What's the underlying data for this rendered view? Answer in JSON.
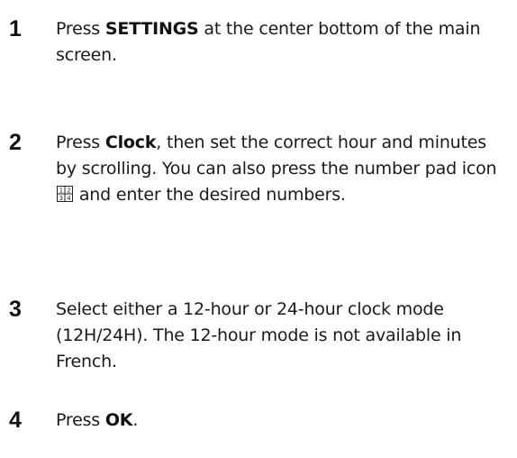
{
  "steps": [
    {
      "number": "1",
      "text_before": "Press ",
      "bold": "SETTINGS",
      "text_after": " at the center bottom of the main screen."
    },
    {
      "number": "2",
      "text_before": "Press ",
      "bold": "Clock",
      "text_mid": ", then set the correct hour and minutes by scrolling. You can also press the number pad icon ",
      "icon": "number-pad-icon",
      "text_after": " and enter the desired numbers."
    },
    {
      "number": "3",
      "text": "Select either a 12-hour or 24-hour clock mode (12H/24H). The 12-hour mode is not available in French."
    },
    {
      "number": "4",
      "text_before": "Press ",
      "bold": "OK",
      "text_after": "."
    }
  ],
  "number_pad_icon": {
    "digits": [
      "1",
      "2",
      "3",
      "4"
    ]
  }
}
